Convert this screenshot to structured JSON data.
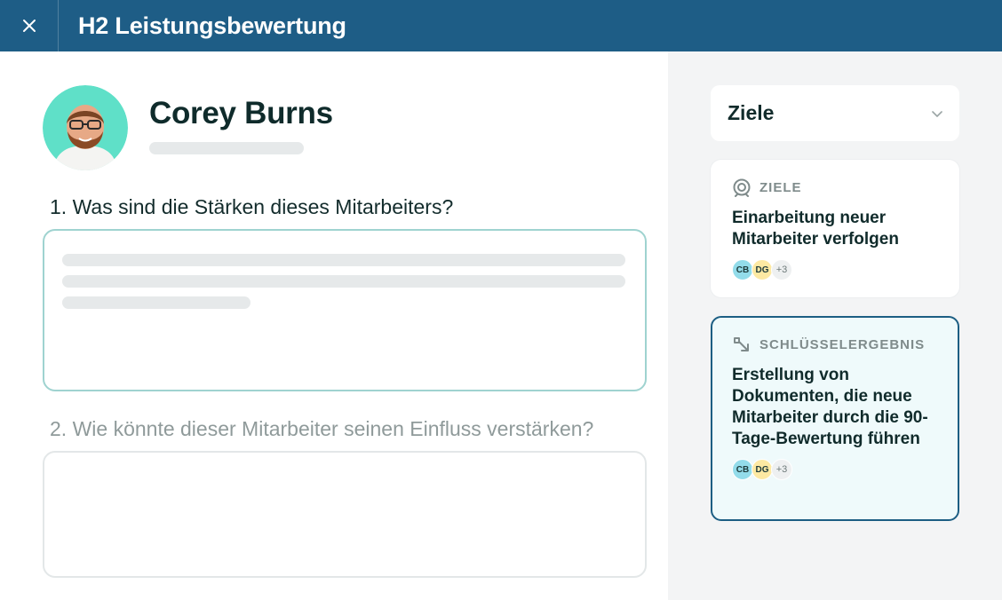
{
  "header": {
    "title": "H2 Leistungsbewertung",
    "close_icon": "close-icon"
  },
  "profile": {
    "name": "Corey Burns",
    "avatar_icon": "avatar"
  },
  "questions": [
    {
      "label": "1. Was sind die Stärken dieses Mitarbeiters?"
    },
    {
      "label": "2. Wie könnte dieser Mitarbeiter seinen Einfluss verstärken?"
    }
  ],
  "sidebar": {
    "dropdown": {
      "label": "Ziele",
      "icon": "chevron-down-icon"
    },
    "cards": [
      {
        "type": "ZIELE",
        "icon": "target-icon",
        "title": "Einarbeitung neuer Mitarbeiter verfolgen",
        "assignees": [
          "CB",
          "DG"
        ],
        "more": "+3"
      },
      {
        "type": "SCHLÜSSELERGEBNIS",
        "icon": "key-result-icon",
        "title": "Erstellung von Dokumenten, die neue Mitarbeiter durch die 90-Tage-Bewertung führen",
        "assignees": [
          "CB",
          "DG"
        ],
        "more": "+3"
      }
    ]
  },
  "colors": {
    "header_bg": "#1e5d86",
    "accent_border": "#9fd3d0",
    "selected_card_border": "#1c5e83",
    "selected_card_bg": "#effafb",
    "sidebar_bg": "#f3f4f5"
  }
}
